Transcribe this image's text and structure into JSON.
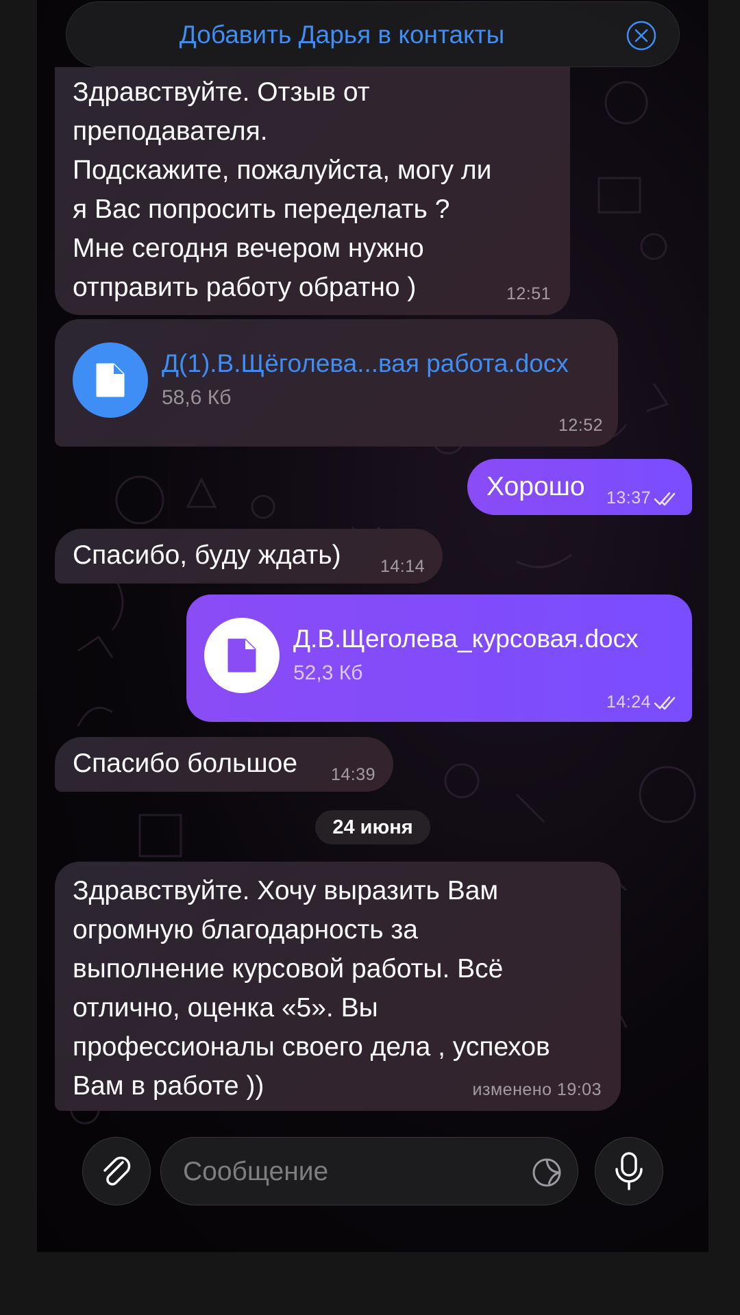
{
  "banner": {
    "text": "Добавить Дарья в контакты"
  },
  "messages": {
    "m1": {
      "lines": [
        "Здравствуйте. Отзыв от",
        "преподавателя.",
        "Подскажите, пожалуйста,  могу ли",
        "я Вас попросить переделать ?",
        "Мне сегодня вечером нужно",
        "отправить работу обратно )"
      ],
      "time": "12:51"
    },
    "m2": {
      "file_name": "Д(1).В.Щёголева...вая работа.docx",
      "file_size": "58,6 Кб",
      "time": "12:52"
    },
    "m3": {
      "text": "Хорошо",
      "time": "13:37"
    },
    "m4": {
      "text": "Спасибо, буду ждать)",
      "time": "14:14"
    },
    "m5": {
      "file_name": "Д.В.Щеголева_курсовая.docx",
      "file_size": "52,3 Кб",
      "time": "14:24"
    },
    "m6": {
      "text": "Спасибо большое",
      "time": "14:39"
    },
    "m7": {
      "lines": [
        "Здравствуйте. Хочу  выразить Вам",
        "огромную благодарность за",
        "выполнение курсовой работы. Всё",
        "отлично, оценка «5». Вы",
        "профессионалы своего дела , успехов",
        "Вам в работе ))"
      ],
      "time": "изменено 19:03"
    }
  },
  "date_separator": "24 июня",
  "input": {
    "placeholder": "Сообщение"
  },
  "colors": {
    "accent": "#3e8ef5",
    "outgoing": "#8a4cf5",
    "incoming": "#2c2532"
  },
  "icons": [
    "close-circle-icon",
    "document-icon",
    "double-check-icon",
    "paperclip-icon",
    "sticker-icon",
    "microphone-icon"
  ]
}
